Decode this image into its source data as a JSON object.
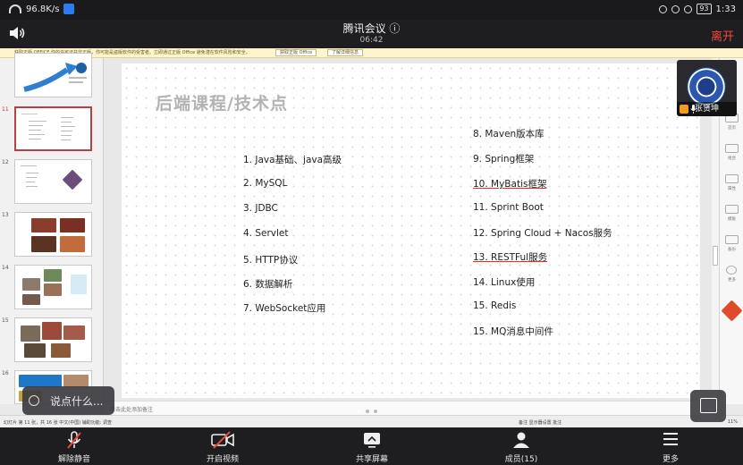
{
  "status_bar": {
    "net_speed": "96.8K/s",
    "battery": "93",
    "clock": "1:33"
  },
  "meeting": {
    "title": "腾讯会议 ⓘ",
    "elapsed": "06:42",
    "leave_label": "离开"
  },
  "banner": {
    "text": "获取正版 OFFICE   你的许可证并非正版，你可能是盗版软件的受害者。立即通过正版 Office 避免潜在软件风险和安全。",
    "btn1": "获取正版 Office",
    "btn2": "了解详细信息"
  },
  "thumbnails": [
    {
      "num": "",
      "selected": false
    },
    {
      "num": "11",
      "selected": true
    },
    {
      "num": "12",
      "selected": false
    },
    {
      "num": "13",
      "selected": false
    },
    {
      "num": "14",
      "selected": false
    },
    {
      "num": "15",
      "selected": false
    },
    {
      "num": "16",
      "selected": false
    }
  ],
  "slide": {
    "title": "后端课程/技术点",
    "left_items": [
      "1.  Java基础、java高级",
      "2.  MySQL",
      "3.  JDBC",
      "4.  Servlet",
      "5.  HTTP协议",
      "6.  数据解析",
      "7.  WebSocket应用"
    ],
    "right_items": [
      "8. Maven版本库",
      "9. Spring框架",
      "10. MyBatis框架",
      "11. Sprint Boot",
      "12. Spring Cloud + Nacos服务",
      "13. RESTFul服务",
      "14. Linux使用",
      "15. Redis",
      "15. MQ消息中间件"
    ]
  },
  "right_panel": [
    "首页",
    "组合",
    "属性",
    "模板",
    "备份",
    "更多"
  ],
  "notes_placeholder": "单击此处添加备注",
  "status_line": {
    "left": "幻灯片 第 11 张，共 16 张   中文(中国)   辅助功能: 调查",
    "right": "备注   显示器设置   批注",
    "zoom": "11%"
  },
  "video": {
    "name": "张贤坤"
  },
  "chat": {
    "placeholder": "说点什么..."
  },
  "toolbar": {
    "unmute": "解除静音",
    "video": "开启视频",
    "share": "共享屏幕",
    "members": "成员(15)",
    "more": "更多"
  },
  "colors": {
    "leave": "#f5473c",
    "accent_red": "#f0463a",
    "selected_thumb": "#b94040"
  }
}
